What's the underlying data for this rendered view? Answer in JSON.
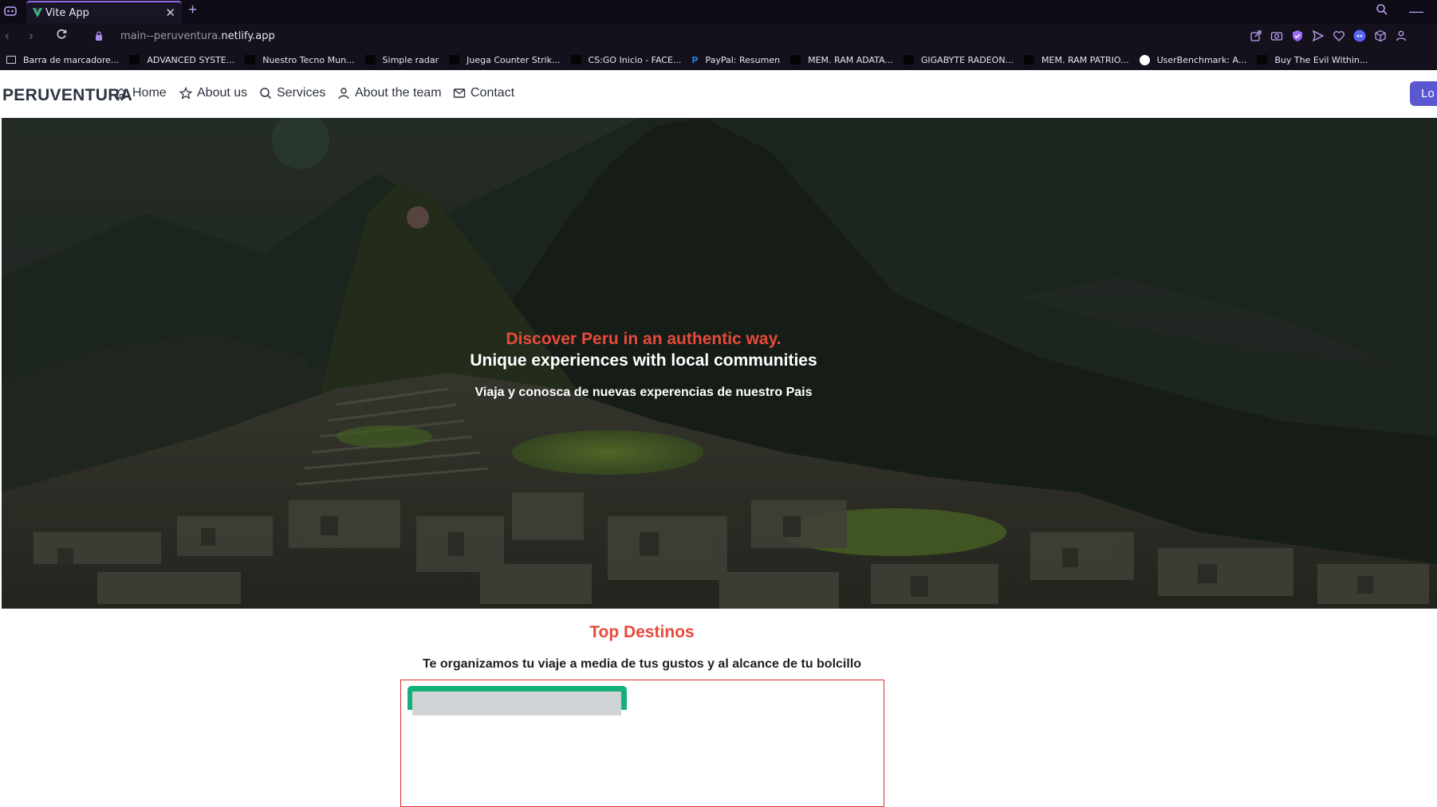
{
  "browser": {
    "tab_title": "Vite App",
    "new_tab_label": "+",
    "url_prefix": "main--peruventura.",
    "url_domain": "netlify.app",
    "bookmarks": [
      {
        "label": "Barra de marcadore...",
        "icon": "folder-icon"
      },
      {
        "label": "ADVANCED SYSTE...",
        "icon": "page-icon"
      },
      {
        "label": "Nuestro Tecno Mun...",
        "icon": "page-icon"
      },
      {
        "label": "Simple radar",
        "icon": "page-icon"
      },
      {
        "label": "Juega Counter Strik...",
        "icon": "page-icon"
      },
      {
        "label": "CS:GO Inicio - FACE...",
        "icon": "page-icon"
      },
      {
        "label": "PayPal: Resumen",
        "icon": "paypal-icon"
      },
      {
        "label": "MEM. RAM ADATA...",
        "icon": "page-icon"
      },
      {
        "label": "GIGABYTE RADEON...",
        "icon": "page-icon"
      },
      {
        "label": "MEM. RAM PATRIO...",
        "icon": "page-icon"
      },
      {
        "label": "UserBenchmark: A...",
        "icon": "userbenchmark-icon"
      },
      {
        "label": "Buy The Evil Within...",
        "icon": "page-icon"
      }
    ]
  },
  "site": {
    "brand": "PERUVENTURA",
    "nav": [
      {
        "label": "Home",
        "icon": "home-icon"
      },
      {
        "label": "About us",
        "icon": "star-icon"
      },
      {
        "label": "Services",
        "icon": "search-icon"
      },
      {
        "label": "About the team",
        "icon": "user-icon"
      },
      {
        "label": "Contact",
        "icon": "mail-icon"
      }
    ],
    "login_label": "Lo"
  },
  "hero": {
    "headline_red": "Discover Peru in an authentic way.",
    "headline_white": "Unique experiences with local communities",
    "subtitle": "Viaja y conosca de nuevas experencias de nuestro Pais"
  },
  "destinos": {
    "title": "Top Destinos",
    "tagline": "Te organizamos tu viaje a media de tus gustos y al alcance de tu bolcillo"
  },
  "colors": {
    "accent_red": "#e84a3a",
    "login_button": "#5b57d1",
    "card_green": "#14b07a",
    "browser_accent": "#8f6be8"
  }
}
